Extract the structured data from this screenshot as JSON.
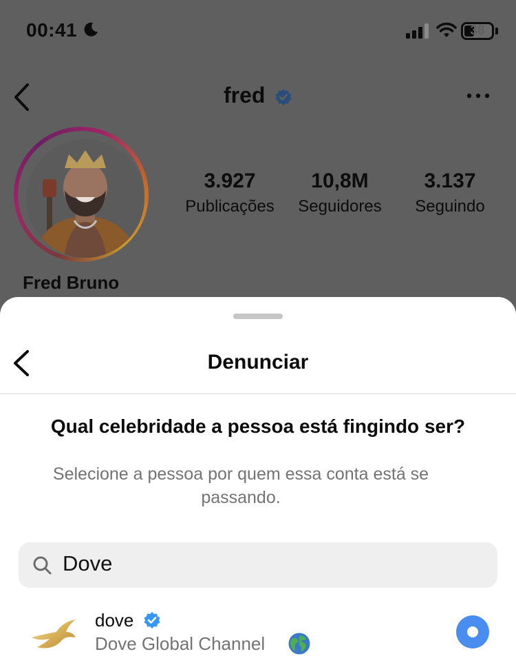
{
  "status_bar": {
    "time": "00:41",
    "battery": "38"
  },
  "profile": {
    "username": "fred",
    "full_name": "Fred Bruno",
    "stats": [
      {
        "value": "3.927",
        "label": "Publicações"
      },
      {
        "value": "10,8M",
        "label": "Seguidores"
      },
      {
        "value": "3.137",
        "label": "Seguindo"
      }
    ]
  },
  "sheet": {
    "title": "Denunciar",
    "question": "Qual celebridade a pessoa está fingindo ser?",
    "subtext": "Selecione a pessoa por quem essa conta está se passando.",
    "search": {
      "value": "Dove"
    },
    "results": [
      {
        "name": "dove",
        "subtitle": "Dove Global Channel",
        "verified": true,
        "selected": true
      }
    ]
  },
  "colors": {
    "accent": "#4a8df0",
    "verified": "#3897f0",
    "dim_overlay": "#5f5f5f",
    "sheet_bg": "#ffffff",
    "secondary_text": "#737373"
  },
  "icons": [
    "moon-icon",
    "cellular-signal-icon",
    "wifi-icon",
    "battery-icon",
    "back-chevron-icon",
    "verified-badge-icon",
    "more-icon",
    "search-icon",
    "dove-logo-icon",
    "globe-icon",
    "radio-selected-icon"
  ]
}
